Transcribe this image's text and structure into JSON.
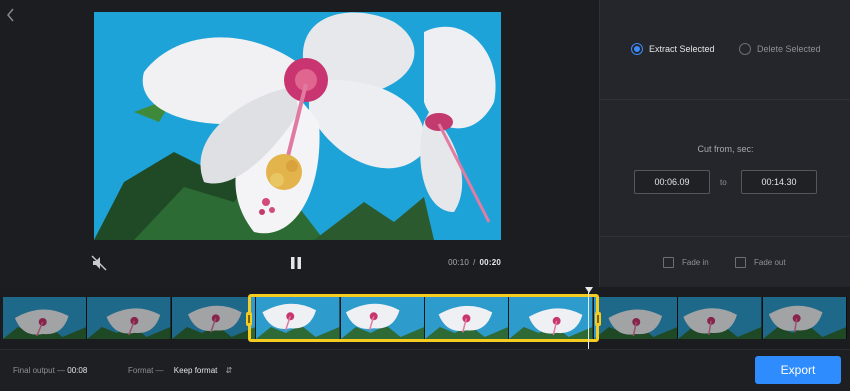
{
  "playback": {
    "current_time": "00:10",
    "separator": "/",
    "duration": "00:20"
  },
  "mode": {
    "extract_label": "Extract Selected",
    "delete_label": "Delete Selected",
    "selected": "extract"
  },
  "cut": {
    "label": "Cut from, sec:",
    "from": "00:06.09",
    "to_label": "to",
    "to": "00:14.30"
  },
  "fade": {
    "fade_in_label": "Fade in",
    "fade_in_checked": false,
    "fade_out_label": "Fade out",
    "fade_out_checked": false
  },
  "footer": {
    "final_output_label": "Final output —",
    "final_output_value": "00:08",
    "format_label": "Format —",
    "format_value": "Keep format",
    "export_label": "Export"
  },
  "icons": {
    "back": "chevron-left-icon",
    "mute": "speaker-muted-icon",
    "pause": "pause-icon",
    "format_caret": "up-down-caret-icon"
  },
  "colors": {
    "accent": "#2e8cff",
    "selection": "#f5cc1f",
    "background": "#1e1f23",
    "panel": "#25262b"
  }
}
